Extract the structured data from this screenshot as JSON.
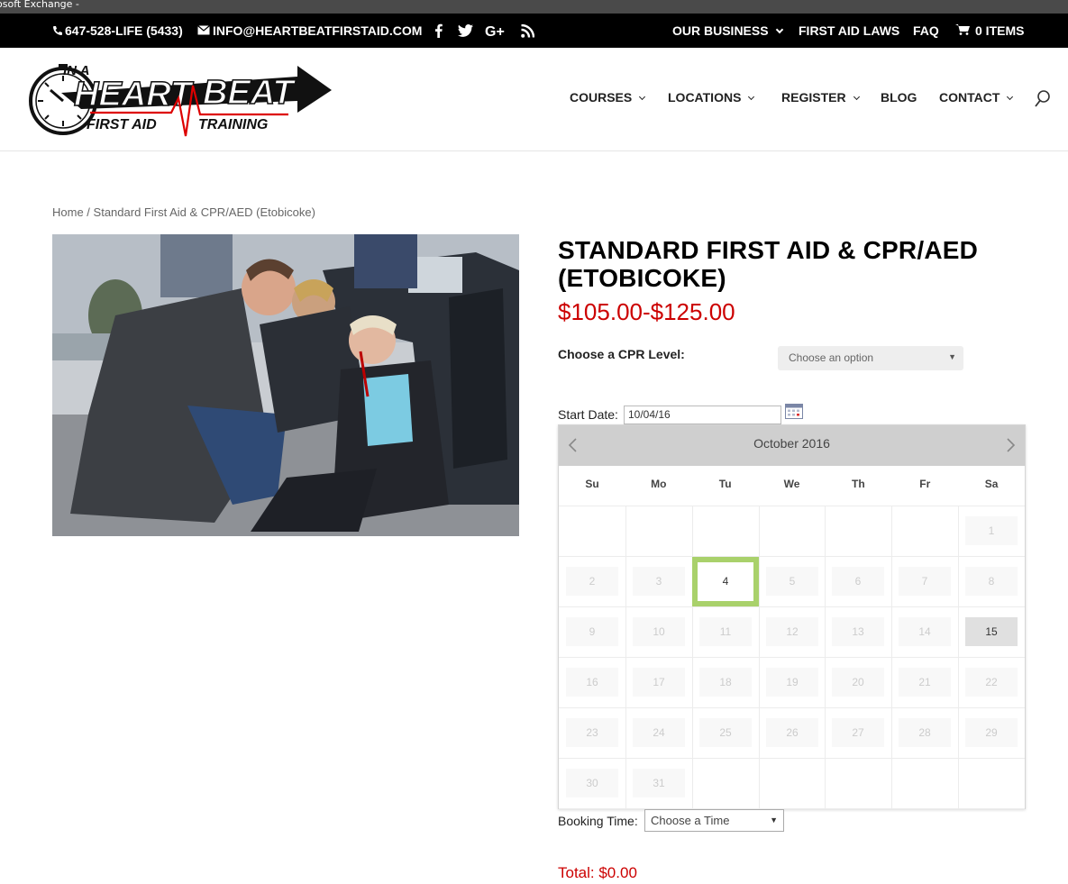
{
  "browser": {
    "tab_fragment": "osoft Exchange -"
  },
  "topbar": {
    "phone": "647-528-LIFE (5433)",
    "email": "INFO@HEARTBEATFIRSTAID.COM",
    "social_icons": [
      "facebook-icon",
      "twitter-icon",
      "google-plus-icon",
      "rss-icon"
    ],
    "menu": [
      "OUR BUSINESS",
      "FIRST AID LAWS",
      "FAQ"
    ],
    "cart_label": "0 ITEMS"
  },
  "logo": {
    "line1": "IN A",
    "line2a": "HEART",
    "line2b": "BEAT",
    "line3a": "FIRST AID",
    "line3b": "TRAINING"
  },
  "nav": {
    "items": [
      "COURSES",
      "LOCATIONS",
      "REGISTER",
      "BLOG",
      "CONTACT"
    ]
  },
  "breadcrumb": {
    "home": "Home",
    "separator": " / ",
    "current": "Standard First Aid & CPR/AED (Etobicoke)"
  },
  "product": {
    "title": "STANDARD FIRST AID & CPR/AED (ETOBICOKE)",
    "price": "$105.00-$125.00",
    "cpr_label": "Choose a CPR Level:",
    "cpr_placeholder": "Choose an option",
    "start_label": "Start Date:",
    "start_value": "10/04/16",
    "booking_label": "Booking Time:",
    "booking_placeholder": "Choose a Time",
    "total": "Total: $0.00"
  },
  "calendar": {
    "month": "October 2016",
    "weekdays": [
      "Su",
      "Mo",
      "Tu",
      "We",
      "Th",
      "Fr",
      "Sa"
    ],
    "first_weekday_index": 6,
    "days_in_month": 31,
    "selected_day": 4,
    "available_days": [
      15
    ]
  },
  "colors": {
    "accent_red": "#cc0000",
    "selected_green": "#a9d16b",
    "topbar_bg": "#000000"
  }
}
